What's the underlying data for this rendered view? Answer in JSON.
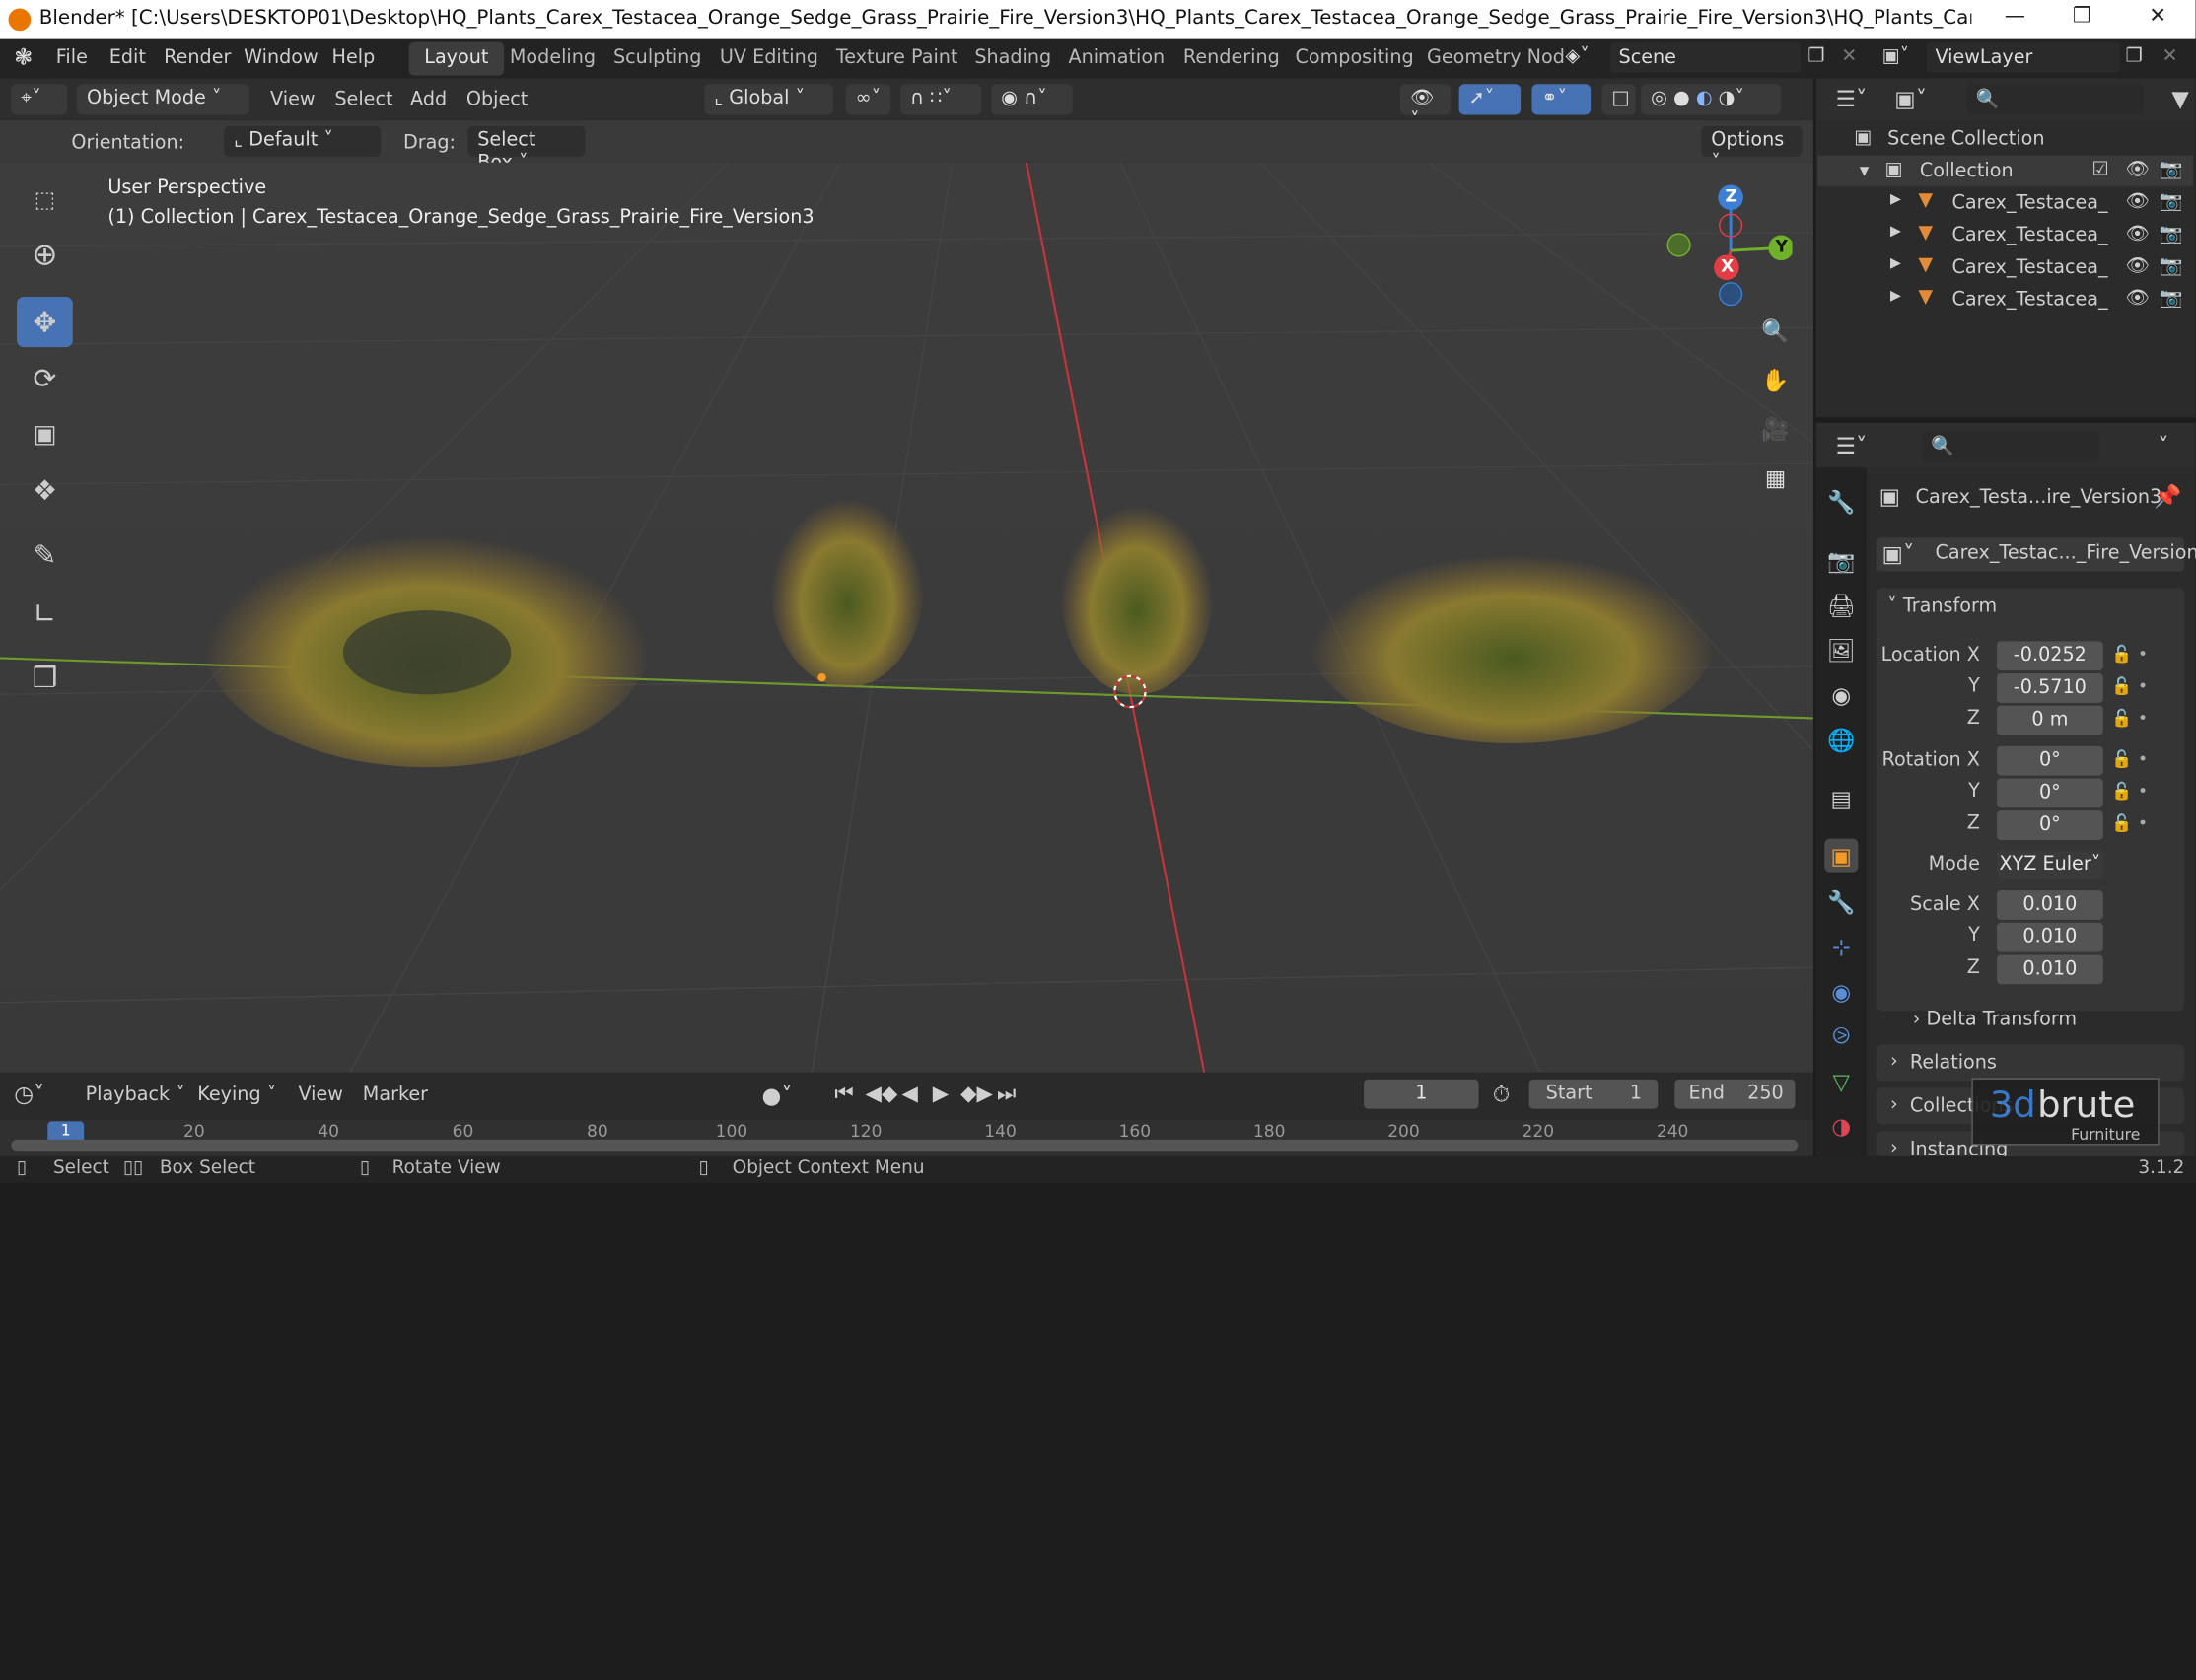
{
  "window": {
    "title": "Blender* [C:\\Users\\DESKTOP01\\Desktop\\HQ_Plants_Carex_Testacea_Orange_Sedge_Grass_Prairie_Fire_Version3\\HQ_Plants_Carex_Testacea_Orange_Sedge_Grass_Prairie_Fire_Version3\\HQ_Plants_Carex_Testacea_Orange_Sedge_Gr..."
  },
  "menu": {
    "file": "File",
    "edit": "Edit",
    "render": "Render",
    "window": "Window",
    "help": "Help"
  },
  "workspaces": [
    "Layout",
    "Modeling",
    "Sculpting",
    "UV Editing",
    "Texture Paint",
    "Shading",
    "Animation",
    "Rendering",
    "Compositing",
    "Geometry Nod"
  ],
  "scene": "Scene",
  "view_layer": "ViewLayer",
  "header": {
    "mode": "Object Mode",
    "view": "View",
    "select": "Select",
    "add": "Add",
    "object": "Object",
    "transform_orientation": "Global"
  },
  "tool_settings": {
    "orientation_label": "Orientation:",
    "orientation_value": "Default",
    "drag_label": "Drag:",
    "drag_value": "Select Box",
    "options": "Options"
  },
  "viewport": {
    "perspective": "User Perspective",
    "collection_info": "(1) Collection | Carex_Testacea_Orange_Sedge_Grass_Prairie_Fire_Version3"
  },
  "gizmo": {
    "z": "Z",
    "y": "Y",
    "x": "X"
  },
  "outliner": {
    "scene_collection": "Scene Collection",
    "collection": "Collection",
    "items": [
      "Carex_Testacea_",
      "Carex_Testacea_",
      "Carex_Testacea_",
      "Carex_Testacea_"
    ]
  },
  "properties": {
    "object_name": "Carex_Testa...ire_Version3",
    "data_name": "Carex_Testac..._Fire_Version3",
    "transform": "Transform",
    "location_label": "Location X",
    "location_x": "-0.0252",
    "location_y": "-0.5710",
    "location_z": "0 m",
    "rotation_label": "Rotation X",
    "rotation_x": "0°",
    "rotation_y": "0°",
    "rotation_z": "0°",
    "mode_label": "Mode",
    "mode_value": "XYZ Euler",
    "scale_label": "Scale X",
    "scale_x": "0.010",
    "scale_y": "0.010",
    "scale_z": "0.010",
    "y": "Y",
    "z": "Z",
    "delta_transform": "Delta Transform",
    "relations": "Relations",
    "collections": "Collections",
    "instancing": "Instancing"
  },
  "timeline": {
    "playback": "Playback",
    "keying": "Keying",
    "view": "View",
    "marker": "Marker",
    "current_frame": "1",
    "start_label": "Start",
    "start_value": "1",
    "end_label": "End",
    "end_value": "250",
    "ruler": [
      "1",
      "20",
      "40",
      "60",
      "80",
      "100",
      "120",
      "140",
      "160",
      "180",
      "200",
      "220",
      "240"
    ]
  },
  "status": {
    "select": "Select",
    "box_select": "Box Select",
    "rotate_view": "Rotate View",
    "context_menu": "Object Context Menu",
    "version": "3.1.2"
  },
  "watermark": {
    "brand_a": "3d",
    "brand_b": "brute",
    "sub": "Furniture"
  }
}
